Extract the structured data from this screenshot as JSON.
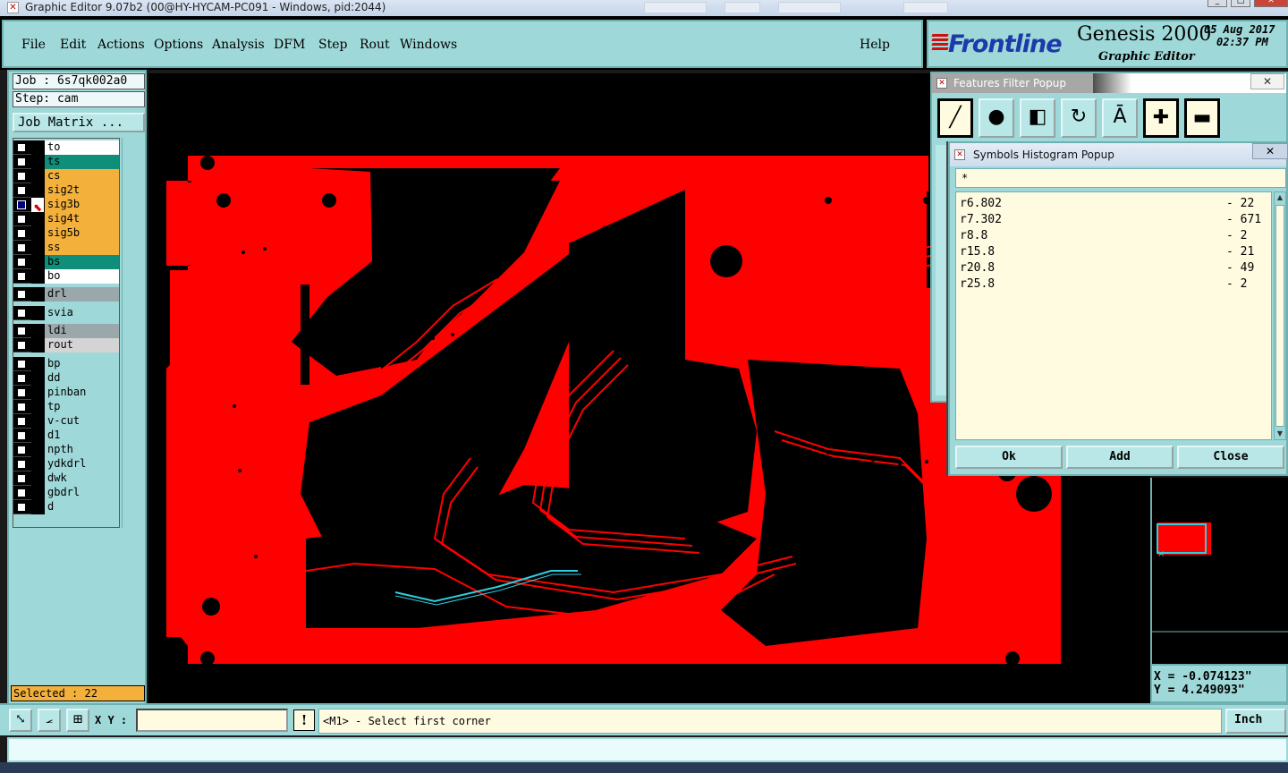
{
  "window": {
    "title": "Graphic Editor 9.07b2 (00@HY-HYCAM-PC091 - Windows, pid:2044)"
  },
  "menu": {
    "items": [
      "File",
      "Edit",
      "Actions",
      "Options",
      "Analysis",
      "DFM",
      "Step",
      "Rout",
      "Windows"
    ],
    "help": "Help"
  },
  "brand": {
    "logo": "Frontline",
    "product": "Genesis 2000",
    "subtitle": "Graphic Editor",
    "date": "05 Aug 2017",
    "time": "02:37 PM"
  },
  "left_panel": {
    "job": "Job : 6s7qk002a0",
    "step": "Step: cam",
    "job_matrix_button": "Job Matrix ...",
    "layers": [
      {
        "name": "to",
        "color": "#ffffff"
      },
      {
        "name": "ts",
        "color": "#0f8f7a"
      },
      {
        "name": "cs",
        "color": "#f3b13c"
      },
      {
        "name": "sig2t",
        "color": "#f3b13c"
      },
      {
        "name": "sig3b",
        "color": "#f3b13c",
        "checked": true
      },
      {
        "name": "sig4t",
        "color": "#f3b13c"
      },
      {
        "name": "sig5b",
        "color": "#f3b13c"
      },
      {
        "name": "ss",
        "color": "#f3b13c"
      },
      {
        "name": "bs",
        "color": "#0f8f7a"
      },
      {
        "name": "bo",
        "color": "#ffffff"
      },
      {
        "name": "drl",
        "color": "#9aa7ab"
      },
      {
        "name": "svia",
        "color": "#9fd8d8"
      },
      {
        "name": "ldi",
        "color": "#9aa7ab"
      },
      {
        "name": "rout",
        "color": "#d4d4d4"
      },
      {
        "name": "bp",
        "color": "#9fd8d8"
      },
      {
        "name": "dd",
        "color": "#9fd8d8"
      },
      {
        "name": "pinban",
        "color": "#9fd8d8"
      },
      {
        "name": "tp",
        "color": "#9fd8d8"
      },
      {
        "name": "v-cut",
        "color": "#9fd8d8"
      },
      {
        "name": "d1",
        "color": "#9fd8d8"
      },
      {
        "name": "npth",
        "color": "#9fd8d8"
      },
      {
        "name": "ydkdrl",
        "color": "#9fd8d8"
      },
      {
        "name": "dwk",
        "color": "#9fd8d8"
      },
      {
        "name": "gbdrl",
        "color": "#9fd8d8"
      },
      {
        "name": "d",
        "color": "#9fd8d8"
      }
    ],
    "selected": "Selected : 22"
  },
  "features_filter": {
    "title": "Features Filter Popup"
  },
  "symbols_histogram": {
    "title": "Symbols Histogram Popup",
    "filter": "*",
    "rows": [
      {
        "symbol": "r6.802",
        "count": "- 22"
      },
      {
        "symbol": "r7.302",
        "count": "- 671"
      },
      {
        "symbol": "r8.8",
        "count": "- 2"
      },
      {
        "symbol": "r15.8",
        "count": "- 21"
      },
      {
        "symbol": "r20.8",
        "count": "- 49"
      },
      {
        "symbol": "r25.8",
        "count": "- 2"
      }
    ],
    "buttons": {
      "ok": "Ok",
      "add": "Add",
      "close": "Close"
    }
  },
  "coords": {
    "x": "X = -0.074123\"",
    "y": "Y = 4.249093\""
  },
  "command_bar": {
    "xy_label": "X Y :",
    "xy_value": "",
    "prompt": "<M1> - Select first corner",
    "unit": "Inch"
  },
  "colors": {
    "panel": "#9fd8d8",
    "copper": "#ff0000",
    "highlight": "#2ecfe0",
    "canvas": "#000000"
  }
}
